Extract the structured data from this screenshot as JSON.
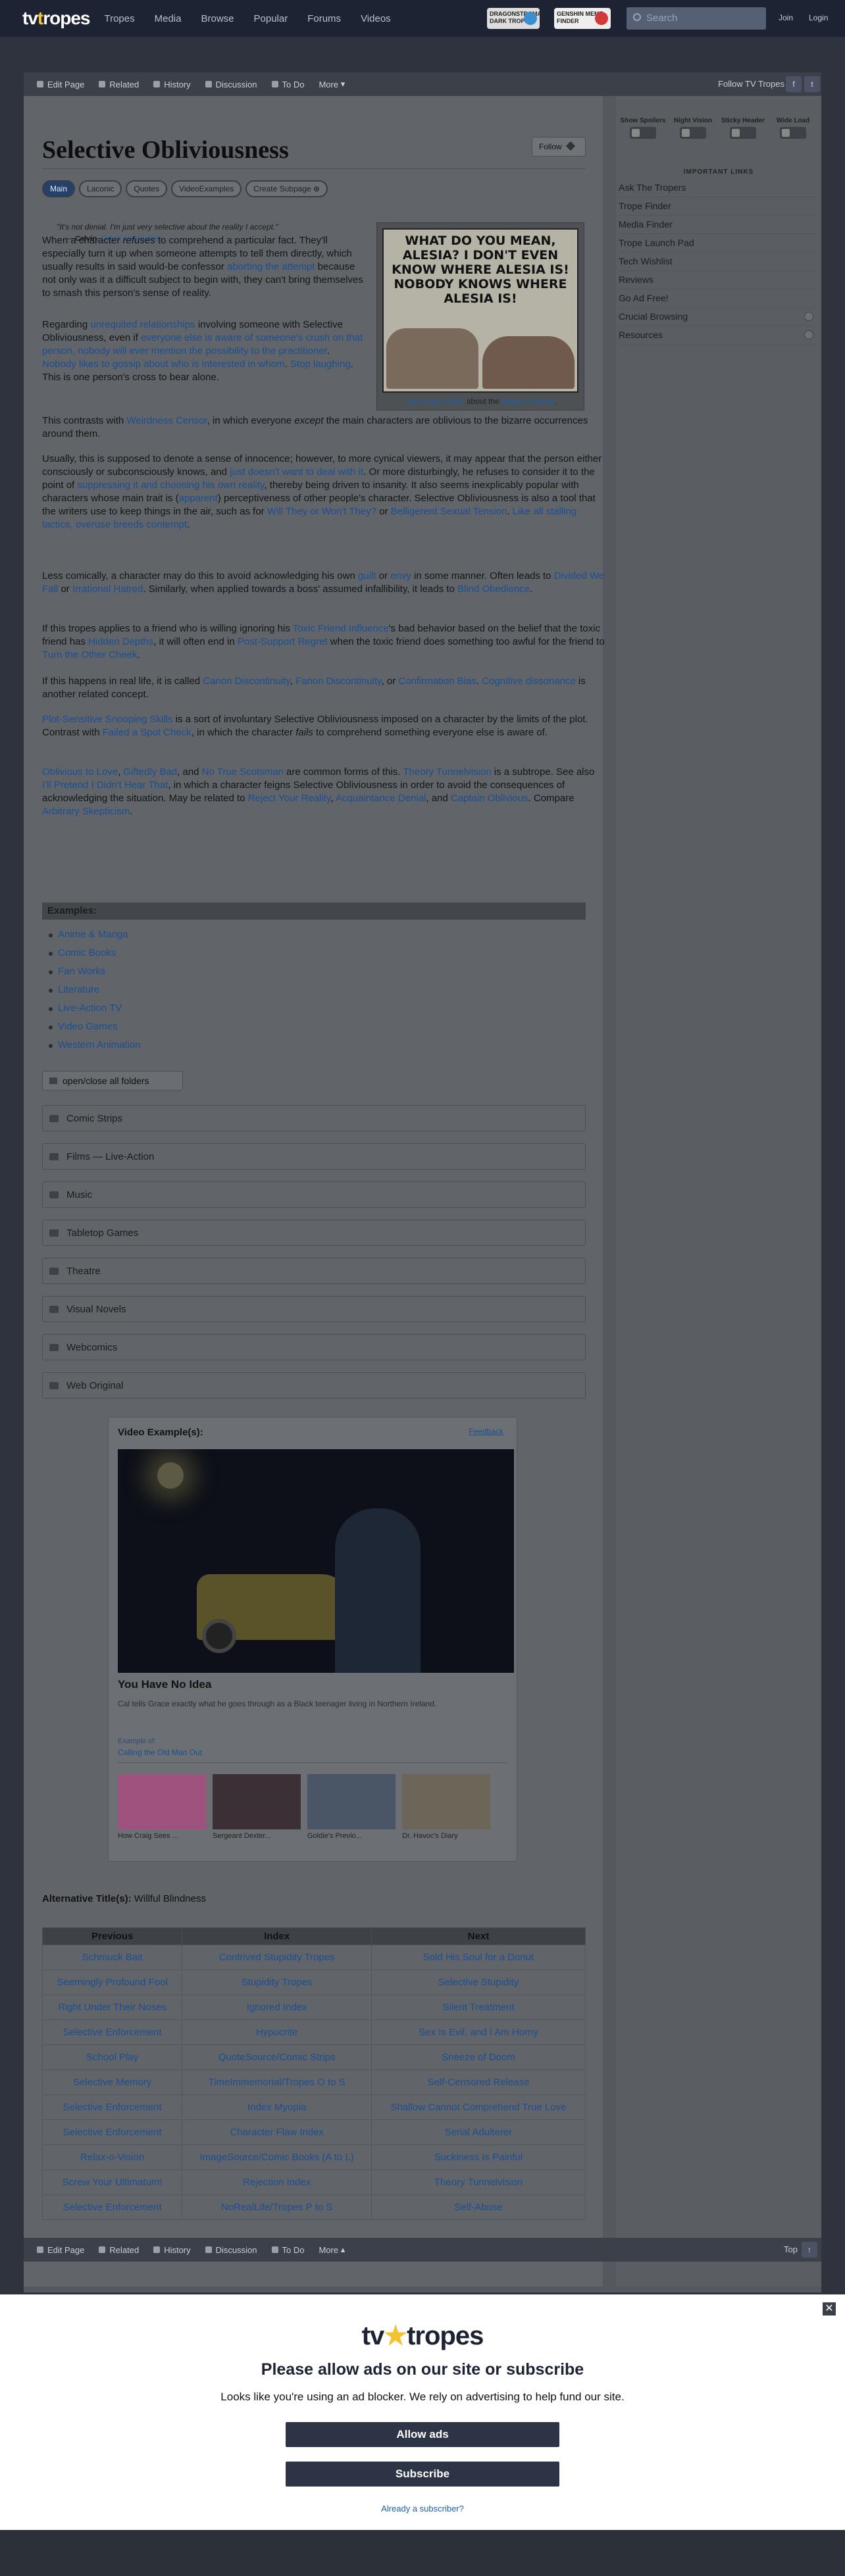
{
  "header": {
    "logo_main": "tv",
    "logo_y": "t",
    "logo_rest": "ropes",
    "nav": [
      "Tropes",
      "Media",
      "Browse",
      "Popular",
      "Forums",
      "Videos"
    ],
    "promo1": "DRAGONSTROMA DARK TROPES",
    "promo2": "GENSHIN MEME FINDER",
    "search_placeholder": "Search",
    "join": "Join",
    "login": "Login"
  },
  "actions": {
    "items": [
      "Edit Page",
      "Related",
      "History",
      "Discussion",
      "To Do",
      "More"
    ],
    "follow_tv": "Follow TV Tropes"
  },
  "article": {
    "title": "Selective Obliviousness",
    "follow": "Follow",
    "tabs": [
      "Main",
      "Laconic",
      "Quotes",
      "VideoExamples",
      "Create Subpage"
    ],
    "quote": "\"It's not denial. I'm just very selective about the reality I accept.\"",
    "quote_attr_prefix": "— ",
    "quote_attr_name": "Calvin",
    "quote_attr_comma": ", ",
    "quote_attr_source": "Calvin and Hobbes",
    "comic_text": "WHAT DO YOU MEAN, ALESIA? I DON'T EVEN KNOW WHERE ALESIA IS! NOBODY KNOWS WHERE ALESIA IS!",
    "comic_cap_a": "Don't ask a Gaul",
    "comic_cap_b": " about the ",
    "comic_cap_c": "Battle of Alesia",
    "comic_cap_d": "."
  },
  "examples": {
    "header": "Examples:",
    "list": [
      "Anime & Manga",
      "Comic Books",
      "Fan Works",
      "Literature",
      "Live-Action TV",
      "Video Games",
      "Western Animation"
    ],
    "openall": "open/close all folders",
    "folders": [
      "Comic Strips",
      "Films — Live-Action",
      "Music",
      "Tabletop Games",
      "Theatre",
      "Visual Novels",
      "Webcomics",
      "Web Original"
    ]
  },
  "video": {
    "heading": "Video Example(s):",
    "feedback": "Feedback",
    "title": "You Have No Idea",
    "desc": "Cal tells Grace exactly what he goes through as a Black teenager living in Northern Ireland.",
    "example_of": "Example of:",
    "example_link": "Calling the Old Man Out",
    "thumbs": [
      "How Craig Sees ...",
      "Sergeant Dexter...",
      "Goldie's Previo...",
      "Dr. Havoc's Diary"
    ]
  },
  "alt": {
    "label": "Alternative Title(s):",
    "value": " Willful Blindness"
  },
  "nav_table": {
    "headers": [
      "Previous",
      "Index",
      "Next"
    ],
    "rows": [
      [
        "Schmuck Bait",
        "Contrived Stupidity Tropes",
        "Sold His Soul for a Donut"
      ],
      [
        "Seemingly Profound Fool",
        "Stupidity Tropes",
        "Selective Stupidity"
      ],
      [
        "Right Under Their Noses",
        "Ignored Index",
        "Silent Treatment"
      ],
      [
        "Selective Enforcement",
        "Hypocrite",
        "Sex Is Evil, and I Am Horny"
      ],
      [
        "School Play",
        "QuoteSource/Comic Strips",
        "Sneeze of Doom"
      ],
      [
        "Selective Memory",
        "TimeImmemorial/Tropes O to S",
        "Self-Censored Release"
      ],
      [
        "Selective Enforcement",
        "Index Myopia",
        "Shallow Cannot Comprehend True Love"
      ],
      [
        "Selective Enforcement",
        "Character Flaw Index",
        "Serial Adulterer"
      ],
      [
        "Relax-o-Vision",
        "ImageSource/Comic Books (A to L)",
        "Suckiness Is Painful"
      ],
      [
        "Screw Your Ultimatum!",
        "Rejection Index",
        "Theory Tunnelvision"
      ],
      [
        "Selective Enforcement",
        "NoRealLife/Tropes P to S",
        "Self-Abuse"
      ]
    ]
  },
  "sidebar": {
    "toggles": [
      "Show Spoilers",
      "Night Vision",
      "Sticky Header",
      "Wide Load"
    ],
    "links_heading": "IMPORTANT LINKS",
    "links": [
      "Ask The Tropers",
      "Trope Finder",
      "Media Finder",
      "Trope Launch Pad",
      "Tech Wishlist",
      "Reviews",
      "Go Ad Free!",
      "Crucial Browsing",
      "Resources"
    ]
  },
  "bottom_bar": {
    "top": "Top"
  },
  "overlay": {
    "logo_a": "tv",
    "logo_b": "tropes",
    "title": "Please allow ads on our site or subscribe",
    "subtitle": "Looks like you're using an ad blocker. We rely on advertising to help fund our site.",
    "allow": "Allow ads",
    "subscribe": "Subscribe",
    "already": "Already a subscriber?",
    "close": "✕"
  },
  "colors": {
    "navbar": "#1d2333",
    "link": "#1b4f93",
    "overlay_button": "#2d3445"
  }
}
